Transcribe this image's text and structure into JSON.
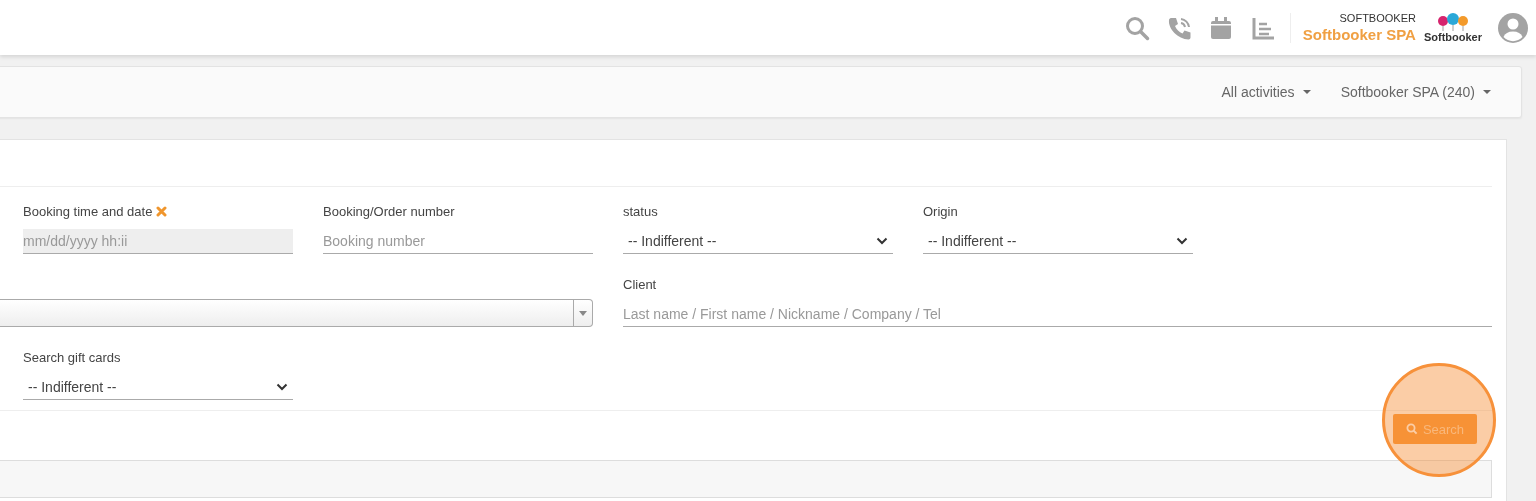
{
  "header": {
    "account_caption": "SOFTBOOKER",
    "account_name": "Softbooker SPA",
    "logo_text": "Softbooker"
  },
  "navbar": {
    "menus": [
      {
        "label": "All activities"
      },
      {
        "label": "Softbooker SPA (240)"
      }
    ]
  },
  "filters": [
    {
      "kind": "input",
      "label": "Booking time and date",
      "clearable": true,
      "placeholder": "mm/dd/yyyy hh:ii",
      "disabled": true
    },
    {
      "kind": "input",
      "label": "Booking/Order number",
      "clearable": false,
      "placeholder": "Booking number",
      "disabled": false
    },
    {
      "kind": "select",
      "label": "status",
      "value": "-- Indifferent --"
    },
    {
      "kind": "select",
      "label": "Origin",
      "value": "-- Indifferent --"
    },
    {
      "kind": "combo"
    },
    {
      "kind": "input",
      "label": "Client",
      "clearable": false,
      "placeholder": "Last name / First name / Nickname / Company / Tel",
      "disabled": false
    },
    {
      "kind": "select",
      "label": "Search gift cards",
      "value": "-- Indifferent --"
    }
  ],
  "search_button": {
    "label": "Search",
    "highlighted": true
  }
}
